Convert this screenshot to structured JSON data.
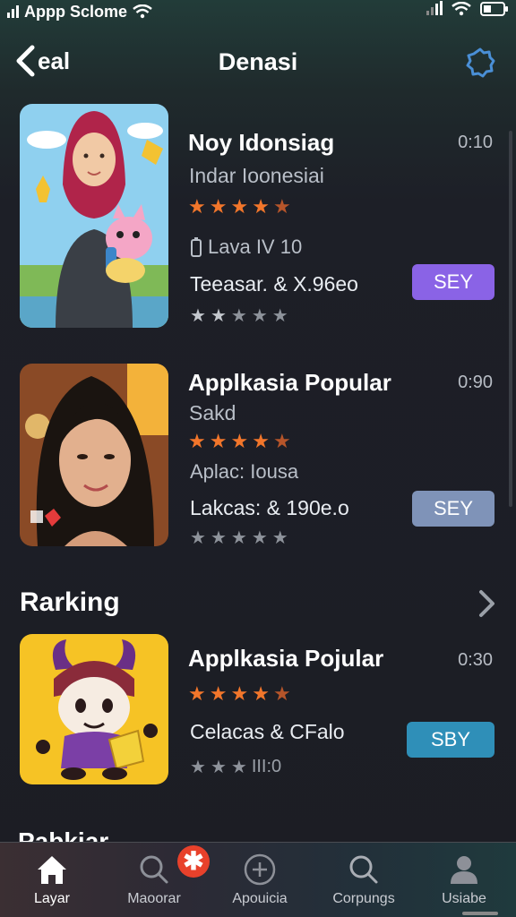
{
  "status_bar": {
    "carrier_text": "Appp Sclome",
    "icons": [
      "signal-icon",
      "wifi-icon",
      "battery-icon"
    ]
  },
  "nav": {
    "back_label": "eal",
    "title": "Denasi",
    "settings_icon": "gear-icon"
  },
  "apps": [
    {
      "name": "Noy Idonsiag",
      "time": "0:10",
      "subtitle": "Indar Ioonesiai",
      "rating": 4.5,
      "meta": "Lava IV 10",
      "price": "Teeasar. & X.96eo",
      "button": "SEY",
      "button_color": "#8a63e6",
      "gray_stars_filled": 2
    },
    {
      "name": "Applkasia Popular",
      "time": "0:90",
      "subtitle": "Sakd",
      "rating": 4.5,
      "meta": "Aplac: Iousa",
      "price": "Lakcas: & 190e.o",
      "button": "SEY",
      "button_color": "#7f93b8",
      "gray_stars_filled": 0
    }
  ],
  "ranking": {
    "header": "Rarking",
    "chevron_icon": "chevron-right-icon",
    "item": {
      "name": "Applkasia Pojular",
      "time": "0:30",
      "rating": 4.5,
      "price": "Celacas & CFalo",
      "stars_text": "III:0",
      "button": "SBY",
      "button_color": "#2f8fb8"
    }
  },
  "cut_off_text": "Pabkiar",
  "tabs": [
    {
      "label": "Layar",
      "icon": "home-icon",
      "active": true
    },
    {
      "label": "Maoorar",
      "icon": "search-icon",
      "active": false
    },
    {
      "label": "Apouicia",
      "icon": "plus-circle-icon",
      "active": false
    },
    {
      "label": "Corpungs",
      "icon": "search-icon",
      "active": false
    },
    {
      "label": "Usiabe",
      "icon": "user-icon",
      "active": false
    }
  ],
  "badge": {
    "icon": "asterisk-icon",
    "symbol": "✱",
    "color": "#e8412b"
  }
}
